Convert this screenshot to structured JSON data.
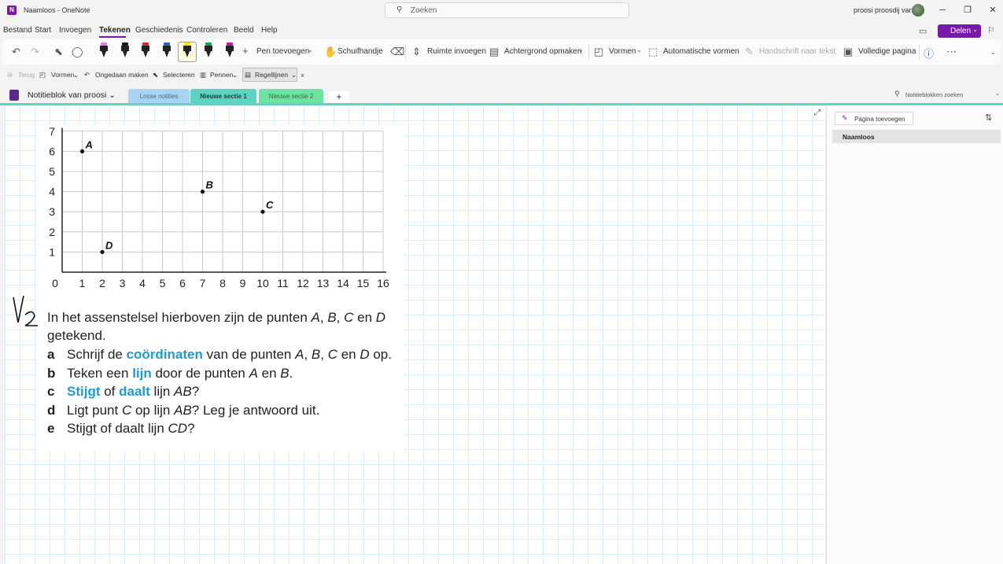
{
  "titlebar": {
    "title": "Naamloos  -  OneNote",
    "search_placeholder": "Zoeken",
    "user": "proosi proosdij van",
    "minimize": "─",
    "restore": "❐",
    "close": "✕"
  },
  "menu": {
    "items": [
      "Bestand",
      "Start",
      "Invoegen",
      "Tekenen",
      "Geschiedenis",
      "Controleren",
      "Beeld",
      "Help"
    ],
    "active": "Tekenen",
    "share_label": "Delen"
  },
  "ribbon": {
    "add_pen": "Pen toevoegen",
    "hand": "Schuifhandje",
    "insert_space": "Ruimte invoegen",
    "background": "Achtergrond opmaken",
    "shapes": "Vormen",
    "auto_shapes": "Automatische vormen",
    "ink_to_text": "Handschrift naar tekst",
    "full_page": "Volledige pagina",
    "pens": [
      {
        "cap": "#e67ae0"
      },
      {
        "cap": "#1a1a1a"
      },
      {
        "cap": "#d8262b"
      },
      {
        "cap": "#2a60c7"
      },
      {
        "cap": "#f6e600"
      },
      {
        "cap": "#18a34a"
      },
      {
        "cap": "#c21aa4"
      }
    ]
  },
  "subtoolbar": {
    "back": "Terug",
    "shapes": "Vormen",
    "undo": "Ongedaan maken",
    "select": "Selecteren",
    "pens": "Pennen",
    "rule_lines": "Regellijnen"
  },
  "sections": {
    "notebook": "Notitieblok van proosi",
    "tabs": [
      {
        "label": "Losse notities",
        "color": "#a9d3f2",
        "text_color": "#4a6b85"
      },
      {
        "label": "Nieuwe sectie 1",
        "color": "#5cd4c1",
        "text_color": "#1e3a36",
        "active": true
      },
      {
        "label": "Nieuwe sectie 2",
        "color": "#6de3a0",
        "text_color": "#2e6a48"
      }
    ],
    "add": "+",
    "notebook_search": "Notitieblokken zoeken"
  },
  "side_panel": {
    "add_page": "Pagina toevoegen",
    "pages": [
      "Naamloos"
    ]
  },
  "chart_data": {
    "type": "scatter",
    "x_ticks": [
      "0",
      "1",
      "2",
      "3",
      "4",
      "5",
      "6",
      "7",
      "8",
      "9",
      "10",
      "11",
      "12",
      "13",
      "14",
      "15",
      "16"
    ],
    "y_ticks": [
      "1",
      "2",
      "3",
      "4",
      "5",
      "6",
      "7"
    ],
    "xlim": [
      0,
      16
    ],
    "ylim": [
      0,
      7
    ],
    "grid": true,
    "points": [
      {
        "label": "A",
        "x": 1,
        "y": 6
      },
      {
        "label": "B",
        "x": 7,
        "y": 4
      },
      {
        "label": "C",
        "x": 10,
        "y": 3
      },
      {
        "label": "D",
        "x": 2,
        "y": 1
      }
    ]
  },
  "exercise": {
    "number": "V2",
    "intro_line1_pre": "In het assenstelsel hierboven zijn de punten ",
    "intro_A": "A",
    "intro_c1": ", ",
    "intro_B": "B",
    "intro_c2": ", ",
    "intro_C": "C",
    "intro_en": " en ",
    "intro_D": "D",
    "intro_line2": "getekend.",
    "questions": [
      {
        "letter": "a",
        "parts": [
          [
            "Schrijf de ",
            ""
          ],
          [
            "coördinaten",
            "kw"
          ],
          [
            " van de punten ",
            ""
          ],
          [
            "A",
            "em"
          ],
          [
            ", ",
            ""
          ],
          [
            "B",
            "em"
          ],
          [
            ", ",
            ""
          ],
          [
            "C",
            "em"
          ],
          [
            " en ",
            ""
          ],
          [
            "D",
            "em"
          ],
          [
            " op.",
            ""
          ]
        ]
      },
      {
        "letter": "b",
        "parts": [
          [
            "Teken een ",
            ""
          ],
          [
            "lijn",
            "kw"
          ],
          [
            " door de punten ",
            ""
          ],
          [
            "A",
            "em"
          ],
          [
            " en ",
            ""
          ],
          [
            "B",
            "em"
          ],
          [
            ".",
            ""
          ]
        ]
      },
      {
        "letter": "c",
        "parts": [
          [
            "Stijgt",
            "kw"
          ],
          [
            " of ",
            ""
          ],
          [
            "daalt",
            "kw"
          ],
          [
            " lijn ",
            ""
          ],
          [
            "AB",
            "em"
          ],
          [
            "?",
            ""
          ]
        ]
      },
      {
        "letter": "d",
        "parts": [
          [
            "Ligt punt ",
            ""
          ],
          [
            "C",
            "em"
          ],
          [
            " op lijn ",
            ""
          ],
          [
            "AB",
            "em"
          ],
          [
            "? Leg je antwoord uit.",
            ""
          ]
        ]
      },
      {
        "letter": "e",
        "parts": [
          [
            "Stijgt of daalt lijn ",
            ""
          ],
          [
            "CD",
            "em"
          ],
          [
            "?",
            ""
          ]
        ]
      }
    ]
  }
}
